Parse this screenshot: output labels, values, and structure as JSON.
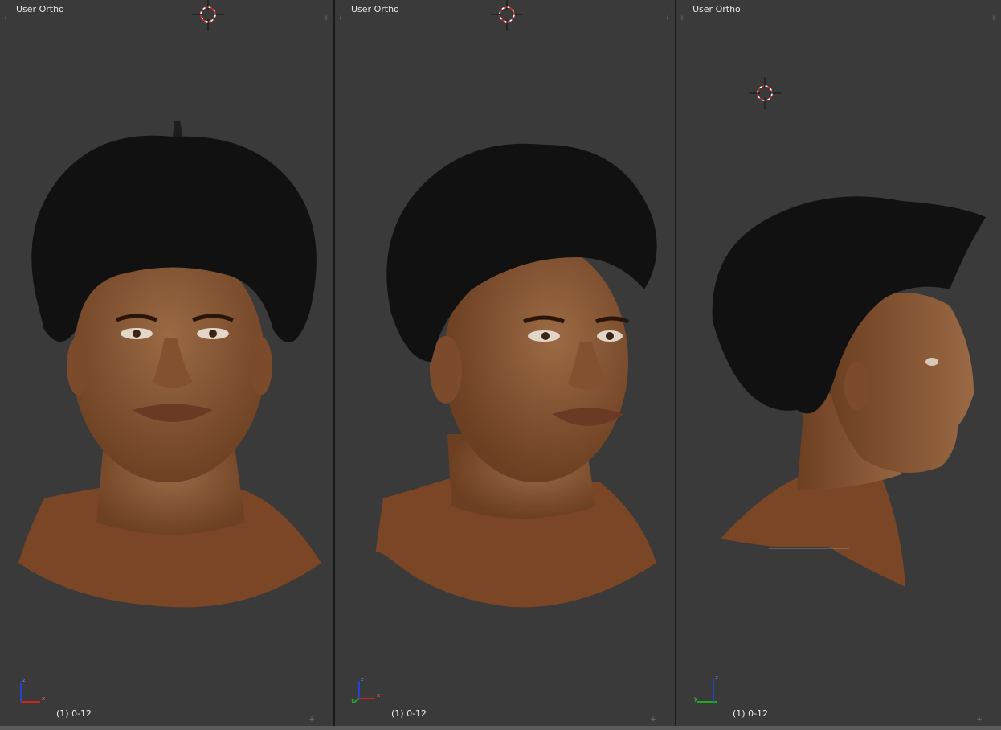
{
  "viewports": [
    {
      "title": "User Ortho",
      "object_info": "(1) 0-12",
      "view": "front"
    },
    {
      "title": "User Ortho",
      "object_info": "(1) 0-12",
      "view": "three-quarter"
    },
    {
      "title": "User Ortho",
      "object_info": "(1) 0-12",
      "view": "side"
    }
  ],
  "axis_labels": {
    "z": "z",
    "x": "x",
    "y": "y"
  },
  "colors": {
    "viewport_bg": "#3a3a3a",
    "skin": "#8b5a36",
    "hair": "#111111",
    "axis_x": "#cc2222",
    "axis_y": "#22aa22",
    "axis_z": "#2244cc"
  },
  "icons": [
    "cursor-3d-icon",
    "axis-gizmo-icon",
    "corner-plus-icon"
  ]
}
